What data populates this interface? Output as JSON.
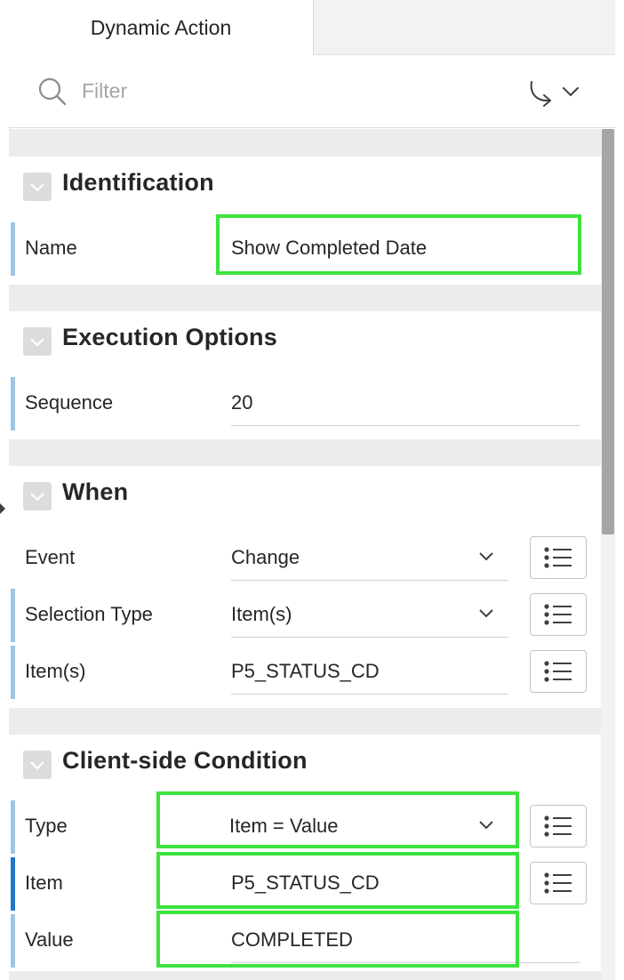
{
  "tabs": {
    "active_label": "Dynamic Action"
  },
  "filter": {
    "placeholder": "Filter"
  },
  "icons": {
    "search": "search-icon",
    "goto": "goto-group-icon",
    "chevron": "chevron-down-icon",
    "list": "list-icon"
  },
  "colors": {
    "highlight": "#3de33d",
    "row_marker": "#9ec5e6",
    "row_marker_active": "#1f78c8"
  },
  "sections": {
    "identification": {
      "title": "Identification",
      "name": {
        "label": "Name",
        "value": "Show Completed Date"
      }
    },
    "execution": {
      "title": "Execution Options",
      "sequence": {
        "label": "Sequence",
        "value": "20"
      }
    },
    "when": {
      "title": "When",
      "event": {
        "label": "Event",
        "value": "Change"
      },
      "selection_type": {
        "label": "Selection Type",
        "value": "Item(s)"
      },
      "items": {
        "label": "Item(s)",
        "value": "P5_STATUS_CD"
      }
    },
    "condition": {
      "title": "Client-side Condition",
      "type": {
        "label": "Type",
        "value": "Item = Value"
      },
      "item": {
        "label": "Item",
        "value": "P5_STATUS_CD"
      },
      "value": {
        "label": "Value",
        "value": "COMPLETED"
      }
    }
  }
}
